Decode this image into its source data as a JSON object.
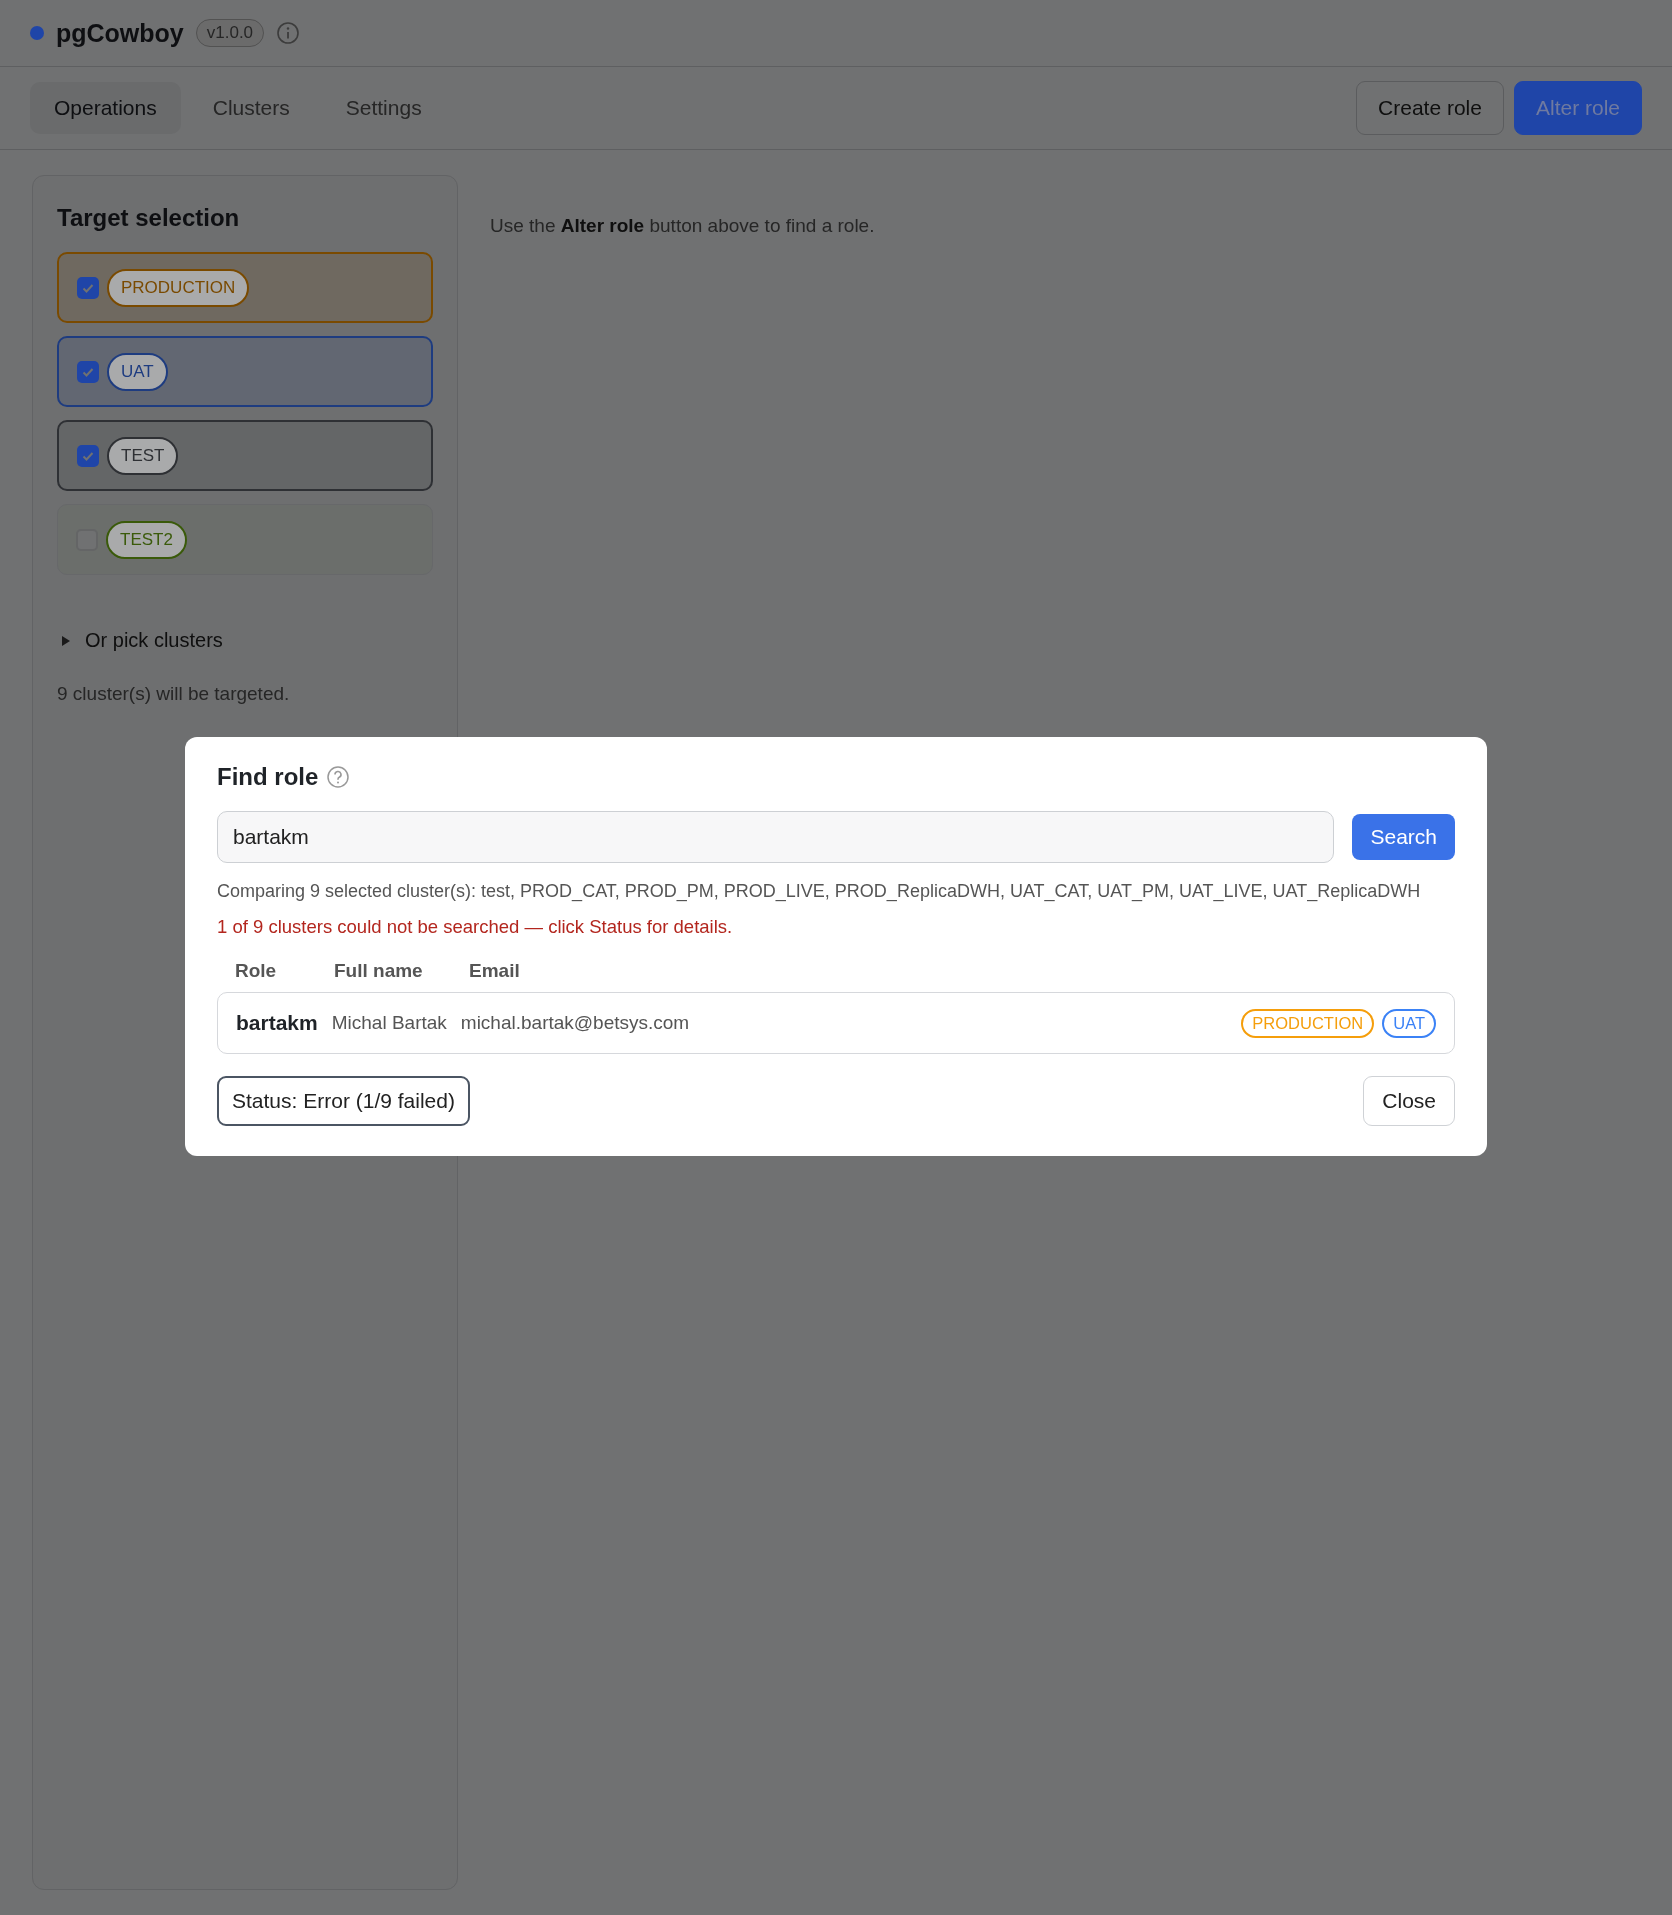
{
  "header": {
    "title": "pgCowboy",
    "version": "v1.0.0"
  },
  "tabs": [
    {
      "label": "Operations",
      "selected": true
    },
    {
      "label": "Clusters",
      "selected": false
    },
    {
      "label": "Settings",
      "selected": false
    }
  ],
  "actions": [
    {
      "label": "Create role",
      "kind": "secondary"
    },
    {
      "label": "Alter role",
      "kind": "primary"
    }
  ],
  "sidebar": {
    "title": "Target selection",
    "environments": [
      {
        "label": "PRODUCTION",
        "checked": true,
        "color": "#7a4a00"
      },
      {
        "label": "UAT",
        "checked": true,
        "color": "#1e3c80"
      },
      {
        "label": "TEST",
        "checked": true,
        "color": "#2e3034"
      },
      {
        "label": "TEST2",
        "checked": false,
        "color": "#3a5a0a"
      }
    ],
    "disclosure": {
      "label": "Or pick clusters",
      "expanded": false
    },
    "summary": "9 cluster(s) will be targeted."
  },
  "main": {
    "hint": "Use the **Alter role** button above to find a role."
  },
  "dialog": {
    "title": "Find role",
    "search_value": "bartakm",
    "search_button": "Search",
    "comparing": "Comparing 9 selected cluster(s): test, PROD_CAT, PROD_PM, PROD_LIVE, PROD_ReplicaDWH, UAT_CAT, UAT_PM, UAT_LIVE, UAT_ReplicaDWH",
    "error": "1 of 9 clusters could not be searched — click Status for details.",
    "columns": [
      "Role",
      "Full name",
      "Email"
    ],
    "rows": [
      {
        "role": "bartakm",
        "full_name": "Michal Bartak",
        "email": "michal.bartak@betsys.com",
        "tags": [
          {
            "label": "PRODUCTION",
            "color": "#f59e0b"
          },
          {
            "label": "UAT",
            "color": "#3b82f6"
          }
        ]
      }
    ],
    "status_button": "Status: Error (1/9 failed)",
    "close_button": "Close"
  }
}
